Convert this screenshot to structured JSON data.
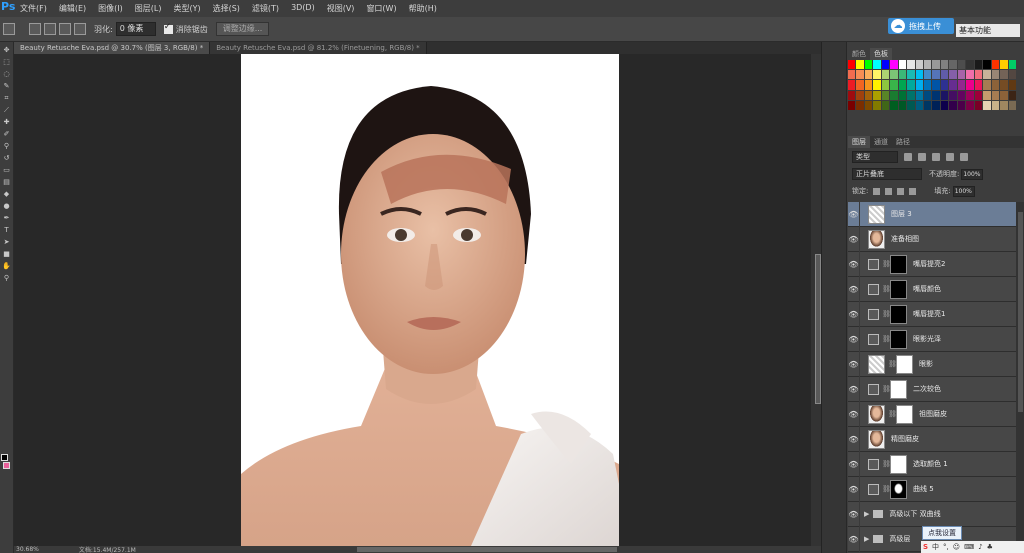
{
  "app": {
    "logo": "Ps"
  },
  "menu": [
    "文件(F)",
    "编辑(E)",
    "图像(I)",
    "图层(L)",
    "类型(Y)",
    "选择(S)",
    "滤镜(T)",
    "3D(D)",
    "视图(V)",
    "窗口(W)",
    "帮助(H)"
  ],
  "options": {
    "feather_label": "羽化:",
    "feather_value": "0 像素",
    "antialias_label": "消除锯齿",
    "refine_button": "调整边缘..."
  },
  "upload_button": "拖拽上传",
  "workspace_select": "基本功能",
  "doc_tabs": [
    {
      "label": "Beauty Retusche Eva.psd @ 30.7% (图层 3, RGB/8) *",
      "active": true
    },
    {
      "label": "Beauty Retusche Eva.psd @ 81.2% (Finetuening, RGB/8) *",
      "active": false
    }
  ],
  "status": {
    "zoom": "30.68%",
    "doc": "文档:15.4M/257.1M"
  },
  "swatch_tabs": [
    "颜色",
    "色板"
  ],
  "palette": [
    "#ff0000",
    "#ffff00",
    "#00ff00",
    "#00ffff",
    "#0000ff",
    "#ff00ff",
    "#ffffff",
    "#e6e6e6",
    "#cccccc",
    "#b3b3b3",
    "#999999",
    "#808080",
    "#666666",
    "#4d4d4d",
    "#333333",
    "#1a1a1a",
    "#000000",
    "#ff3300",
    "#ffcc00",
    "#00cc66",
    "#f26c4f",
    "#f68e55",
    "#fbaf5c",
    "#fff467",
    "#acd372",
    "#7cc576",
    "#3bb878",
    "#1abbb4",
    "#00bff3",
    "#438cca",
    "#5574b9",
    "#605ca8",
    "#855fa8",
    "#a763a8",
    "#f06eaa",
    "#f26d7d",
    "#c7b299",
    "#998675",
    "#736357",
    "#534741",
    "#ed1c24",
    "#f26522",
    "#f7941d",
    "#fff200",
    "#8dc63f",
    "#39b54a",
    "#00a651",
    "#00a99d",
    "#00aeef",
    "#0072bc",
    "#0054a6",
    "#2e3192",
    "#662d91",
    "#92278f",
    "#ec008c",
    "#ed145b",
    "#a67c52",
    "#8c6239",
    "#754c24",
    "#603913",
    "#9e0b0f",
    "#a0410d",
    "#a3620a",
    "#aba000",
    "#598527",
    "#1a7b30",
    "#007236",
    "#00746b",
    "#0076a3",
    "#004a80",
    "#003471",
    "#1b1464",
    "#440e62",
    "#630460",
    "#9e005d",
    "#9e0039",
    "#c69c6d",
    "#a67c52",
    "#8c6239",
    "#3c2415",
    "#790000",
    "#7b2e00",
    "#7d4900",
    "#827b00",
    "#406618",
    "#005e20",
    "#005826",
    "#005952",
    "#005b7f",
    "#003663",
    "#002157",
    "#0d004c",
    "#32004b",
    "#4b0049",
    "#7b0046",
    "#7a0026",
    "#e6d3b3",
    "#c8b28a",
    "#a08760",
    "#7a6a53"
  ],
  "layers_tabs": [
    "图层",
    "通道",
    "路径"
  ],
  "layers_panel": {
    "kind": "类型",
    "blend_mode": "正片叠底",
    "opacity_label": "不透明度:",
    "opacity": "100%",
    "lock_label": "锁定:",
    "fill_label": "填充:",
    "fill": "100%"
  },
  "layers": [
    {
      "name": "图层 3",
      "thumb": "trans",
      "selected": true
    },
    {
      "name": "准备相图",
      "thumb": "face"
    },
    {
      "name": "嘴唇提亮2",
      "thumb": "black",
      "adj": true
    },
    {
      "name": "嘴唇颜色",
      "thumb": "black",
      "adj": true
    },
    {
      "name": "嘴唇提亮1",
      "thumb": "black",
      "adj": true
    },
    {
      "name": "眼影光泽",
      "thumb": "black",
      "adj": true
    },
    {
      "name": "眼影",
      "thumb": "white",
      "trans": true
    },
    {
      "name": "二次较色",
      "thumb": "white",
      "adj": true
    },
    {
      "name": "祖图磨皮",
      "thumb": "white",
      "face": true
    },
    {
      "name": "精图磨皮",
      "thumb": "face"
    },
    {
      "name": "选取颜色 1",
      "thumb": "white",
      "adj": true
    },
    {
      "name": "曲线 5",
      "thumb": "curve",
      "adj": true
    },
    {
      "name": "高级以下 双曲线",
      "group": true
    },
    {
      "name": "高级层",
      "group": true
    }
  ],
  "tooltip": "点我设置",
  "ime": [
    "中",
    "°,",
    "☺",
    "⌨",
    "♪",
    "♣"
  ]
}
